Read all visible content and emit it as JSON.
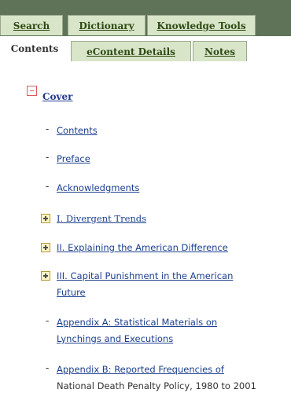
{
  "tabs": {
    "row1": [
      {
        "label": "Search",
        "active": false
      },
      {
        "label": "Dictionary",
        "active": false
      },
      {
        "label": "Knowledge Tools",
        "active": false
      }
    ],
    "row2": [
      {
        "label": "Contents",
        "active": true
      },
      {
        "label": "eContent Details",
        "active": false
      },
      {
        "label": "Notes",
        "active": false
      }
    ]
  },
  "toc": {
    "cover": "Cover",
    "items": [
      {
        "label": "Contents",
        "type": "leaf"
      },
      {
        "label": "Preface",
        "type": "leaf"
      },
      {
        "label": "Acknowledgments",
        "type": "leaf"
      },
      {
        "label": "I. Divergent Trends",
        "type": "expandable"
      },
      {
        "label": "II. Explaining the American Difference",
        "type": "expandable"
      },
      {
        "label": "III. Capital Punishment in the American",
        "label2": "Future",
        "type": "expandable"
      },
      {
        "label": "Appendix A: Statistical Materials on",
        "label2": "Lynchings and Executions",
        "type": "leaf"
      },
      {
        "label": "Appendix B: Reported Frequencies of",
        "label2": "National Death Penalty Policy, 1980 to 2001",
        "type": "leaf"
      }
    ]
  },
  "colors": {
    "tab_bg": "#d8e5c9",
    "tab_bar": "#5f7358",
    "link": "#1c3f8f",
    "collapse_marker": "#e05a5a",
    "expand_marker": "#b2973a"
  }
}
